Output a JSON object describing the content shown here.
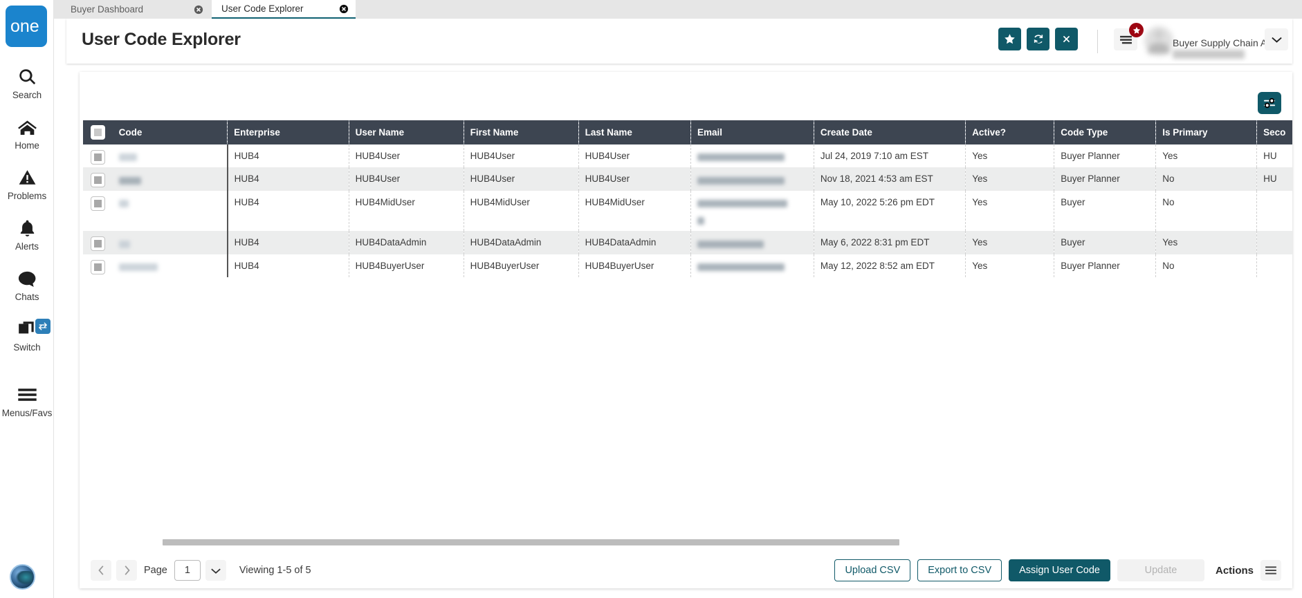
{
  "app": {
    "logo_text": "one",
    "logo_color": "#1b84cd",
    "accent_color": "#105968",
    "header_bar_color": "#3d4551",
    "badge_color": "#9d0612"
  },
  "tabs": [
    {
      "label": "Buyer Dashboard",
      "active": false
    },
    {
      "label": "User Code Explorer",
      "active": true
    }
  ],
  "sidebar": {
    "items": [
      {
        "label": "Search",
        "icon": "search-icon"
      },
      {
        "label": "Home",
        "icon": "home-icon"
      },
      {
        "label": "Problems",
        "icon": "warning-triangle-icon"
      },
      {
        "label": "Alerts",
        "icon": "bell-icon"
      },
      {
        "label": "Chats",
        "icon": "chat-bubble-icon"
      },
      {
        "label": "Switch",
        "icon": "windows-stack-icon",
        "badge_icon": "swap-arrows-icon"
      },
      {
        "label": "Menus/Favs",
        "icon": "hamburger-icon"
      }
    ],
    "assistant_icon": "ai-assistant-orb-icon"
  },
  "header": {
    "title": "User Code Explorer",
    "buttons": [
      {
        "name": "favorite-button",
        "icon": "star-icon"
      },
      {
        "name": "refresh-button",
        "icon": "refresh-icon"
      },
      {
        "name": "close-button",
        "icon": "close-x-icon"
      }
    ],
    "menu_icon": "menu-lines-icon",
    "menu_badge_icon": "star-icon",
    "user": {
      "name": "",
      "role": "Buyer Supply Chain Admin",
      "extra": "",
      "caret_icon": "chevron-down-icon"
    }
  },
  "toolbar": {
    "filter_icon": "sliders-filter-icon"
  },
  "table": {
    "columns": [
      "Code",
      "Enterprise",
      "User Name",
      "First Name",
      "Last Name",
      "Email",
      "Create Date",
      "Active?",
      "Code Type",
      "Is Primary",
      "Seco"
    ],
    "rows": [
      {
        "code": "",
        "enterprise": "HUB4",
        "user_name": "HUB4User",
        "first_name": "HUB4User",
        "last_name": "HUB4User",
        "email": "",
        "create_date": "Jul 24, 2019 7:10 am EST",
        "active": "Yes",
        "code_type": "Buyer Planner",
        "is_primary": "Yes",
        "secondary": "HU"
      },
      {
        "code": "",
        "enterprise": "HUB4",
        "user_name": "HUB4User",
        "first_name": "HUB4User",
        "last_name": "HUB4User",
        "email": "",
        "create_date": "Nov 18, 2021 4:53 am EST",
        "active": "Yes",
        "code_type": "Buyer Planner",
        "is_primary": "No",
        "secondary": "HU"
      },
      {
        "code": "",
        "enterprise": "HUB4",
        "user_name": "HUB4MidUser",
        "first_name": "HUB4MidUser",
        "last_name": "HUB4MidUser",
        "email": "",
        "create_date": "May 10, 2022 5:26 pm EDT",
        "active": "Yes",
        "code_type": "Buyer",
        "is_primary": "No",
        "secondary": ""
      },
      {
        "code": "",
        "enterprise": "HUB4",
        "user_name": "HUB4DataAdmin",
        "first_name": "HUB4DataAdmin",
        "last_name": "HUB4DataAdmin",
        "email": "",
        "create_date": "May 6, 2022 8:31 pm EDT",
        "active": "Yes",
        "code_type": "Buyer",
        "is_primary": "Yes",
        "secondary": ""
      },
      {
        "code": "",
        "enterprise": "HUB4",
        "user_name": "HUB4BuyerUser",
        "first_name": "HUB4BuyerUser",
        "last_name": "HUB4BuyerUser",
        "email": "",
        "create_date": "May 12, 2022 8:52 am EDT",
        "active": "Yes",
        "code_type": "Buyer Planner",
        "is_primary": "No",
        "secondary": ""
      }
    ]
  },
  "footer": {
    "prev_icon": "chevron-left-icon",
    "next_icon": "chevron-right-icon",
    "page_label": "Page",
    "page_value": "1",
    "page_caret_icon": "chevron-down-icon",
    "viewing": "Viewing 1-5 of 5",
    "upload_csv": "Upload CSV",
    "export_csv": "Export to CSV",
    "assign_user_code": "Assign User Code",
    "update": "Update",
    "actions": "Actions",
    "actions_icon": "hamburger-icon"
  }
}
